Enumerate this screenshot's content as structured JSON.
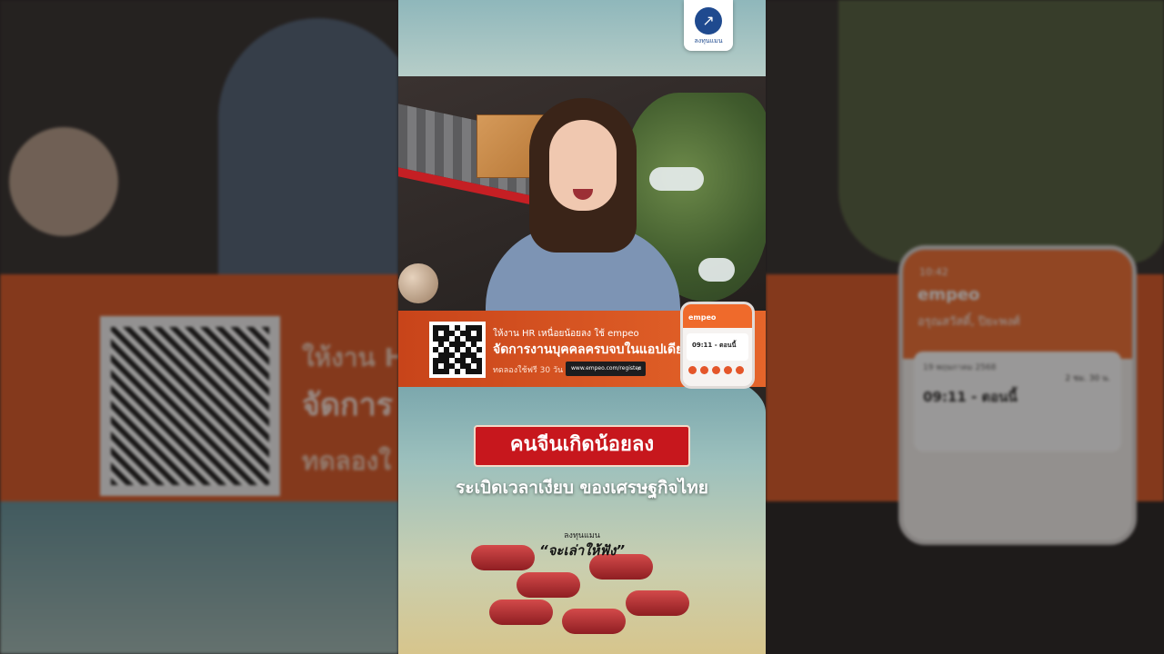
{
  "brand": {
    "logo_label": "ลงทุนแมน",
    "logo_icon": "chart-up-icon"
  },
  "ad": {
    "line1": "ให้งาน HR เหนื่อยน้อยลง ใช้ empeo",
    "line2": "จัดการงานบุคคลครบจบในแอปเดียว",
    "trial": "ทดลองใช้ฟรี 30 วัน",
    "url": "www.empeo.com/register",
    "search_icon": "search-icon",
    "accent": "#e5652a"
  },
  "mini_app": {
    "app_name": "empeo",
    "time_text": "09:11 - ตอนนี้"
  },
  "side_right": {
    "app_name": "empeo",
    "status_time": "10:42",
    "user": "อรุณสวัสดิ์, ปิยะพงศ์",
    "date": "19 พฤษภาคม 2568",
    "clock": "09:11 - ตอนนี้",
    "duration": "2 ชม. 30 น."
  },
  "side_left": {
    "ghost_line1": "ให้งาน H",
    "ghost_line2": "จัดการ",
    "ghost_line3": "ทดลองใ"
  },
  "headline": {
    "title": "คนจีนเกิดน้อยลง",
    "subtitle": "ระเบิดเวลาเงียบ ของเศรษฐกิจไทย",
    "color": "#c7171d"
  },
  "series": {
    "brand": "ลงทุนแมน",
    "tagline": "“จะเล่าให้ฟัง”"
  }
}
